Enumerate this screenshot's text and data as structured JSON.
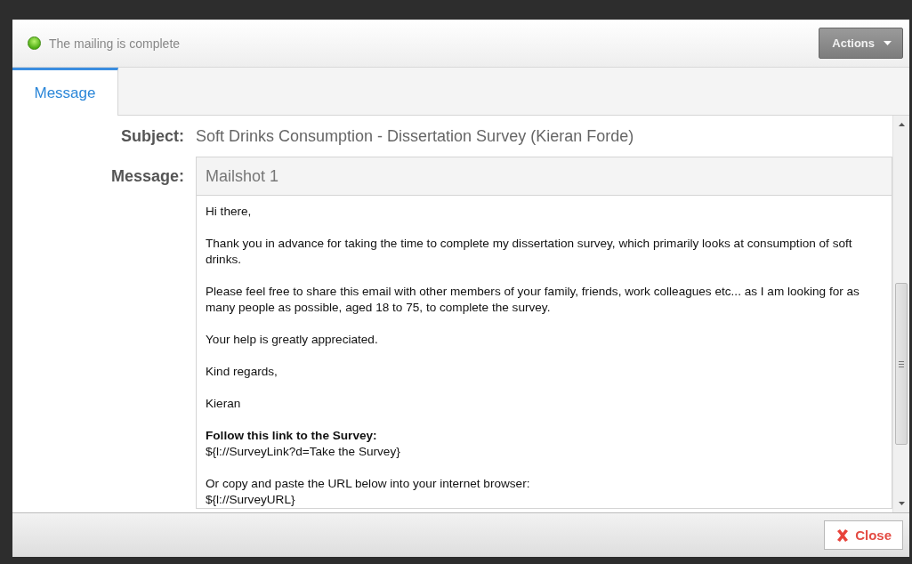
{
  "header": {
    "status": "The mailing is complete",
    "actions_button": "Actions"
  },
  "tabs": [
    {
      "label": "Message",
      "selected": true
    }
  ],
  "subject": {
    "label": "Subject:",
    "value": "Soft Drinks Consumption - Dissertation Survey (Kieran Forde)"
  },
  "message": {
    "label": "Message:",
    "title": "Mailshot 1",
    "paragraphs": [
      {
        "lines": [
          {
            "text": "Hi there,",
            "bold": false
          }
        ]
      },
      {
        "lines": [
          {
            "text": "Thank you in advance for taking the time to complete my dissertation survey, which primarily looks at consumption of soft drinks.",
            "bold": false
          }
        ]
      },
      {
        "lines": [
          {
            "text": "Please feel free to share this email with other members of your family, friends, work colleagues etc... as I am looking for as many people as possible, aged 18 to 75, to complete the survey.",
            "bold": false
          }
        ]
      },
      {
        "lines": [
          {
            "text": "Your help is greatly appreciated.",
            "bold": false
          }
        ]
      },
      {
        "lines": [
          {
            "text": "Kind regards,",
            "bold": false
          }
        ]
      },
      {
        "lines": [
          {
            "text": "Kieran",
            "bold": false
          }
        ]
      },
      {
        "lines": [
          {
            "text": "Follow this link to the Survey:",
            "bold": true
          },
          {
            "text": "${l://SurveyLink?d=Take the Survey}",
            "bold": false
          }
        ]
      },
      {
        "lines": [
          {
            "text": "Or copy and paste the URL below into your internet browser:",
            "bold": false
          },
          {
            "text": "${l://SurveyURL}",
            "bold": false
          }
        ]
      }
    ]
  },
  "footer": {
    "close_button": "Close"
  }
}
